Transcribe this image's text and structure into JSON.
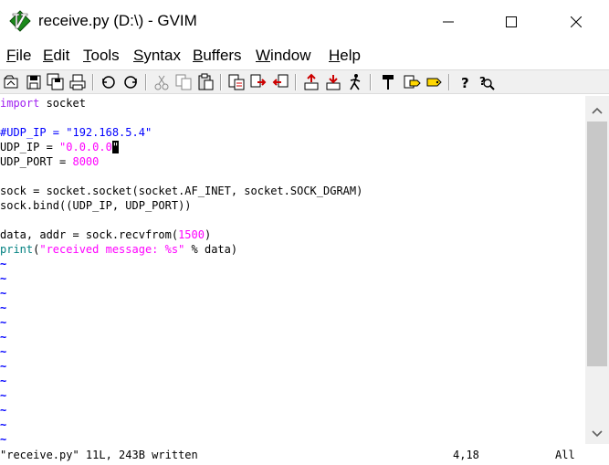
{
  "window": {
    "title": "receive.py (D:\\) - GVIM",
    "icon": "vim-icon"
  },
  "menu": [
    {
      "key": "F",
      "rest": "ile"
    },
    {
      "key": "E",
      "rest": "dit"
    },
    {
      "key": "T",
      "rest": "ools"
    },
    {
      "key": "S",
      "rest": "yntax"
    },
    {
      "key": "B",
      "rest": "uffers"
    },
    {
      "key": "W",
      "rest": "indow"
    },
    {
      "key": "H",
      "rest": "elp"
    }
  ],
  "toolbar": {
    "icons": [
      "open-icon",
      "save-icon",
      "save-all-icon",
      "print-icon",
      "undo-icon",
      "redo-icon",
      "cut-icon",
      "copy-icon",
      "paste-icon",
      "find-replace-icon",
      "find-next-icon",
      "find-prev-icon",
      "load-session-icon",
      "save-session-icon",
      "run-script-icon",
      "make-icon",
      "run-ctags-icon",
      "tag-jump-icon",
      "help-icon",
      "find-help-icon"
    ]
  },
  "buffer": {
    "lines": [
      [
        {
          "t": "import",
          "c": "kw"
        },
        {
          "t": " socket"
        }
      ],
      [],
      [
        {
          "t": "#UDP_IP = \"192.168.5.4\"",
          "c": "cmt"
        }
      ],
      [
        {
          "t": "UDP_IP = "
        },
        {
          "t": "\"0.0.0.0",
          "c": "str"
        },
        {
          "t": "\"",
          "c": "cursor"
        }
      ],
      [
        {
          "t": "UDP_PORT = "
        },
        {
          "t": "8000",
          "c": "num"
        }
      ],
      [],
      [
        {
          "t": "sock = socket.socket(socket.AF_INET, socket.SOCK_DGRAM)"
        }
      ],
      [
        {
          "t": "sock.bind((UDP_IP, UDP_PORT))"
        }
      ],
      [],
      [
        {
          "t": "data, addr = sock.recvfrom("
        },
        {
          "t": "1500",
          "c": "num"
        },
        {
          "t": ")"
        }
      ],
      [
        {
          "t": "print",
          "c": "fn"
        },
        {
          "t": "(",
          "c": ""
        },
        {
          "t": "\"received message: %s\"",
          "c": "str"
        },
        {
          "t": " % data)"
        }
      ]
    ],
    "tilde_count": 13
  },
  "status": {
    "message": "\"receive.py\" 11L, 243B written",
    "position": "4,18",
    "percent": "All"
  }
}
